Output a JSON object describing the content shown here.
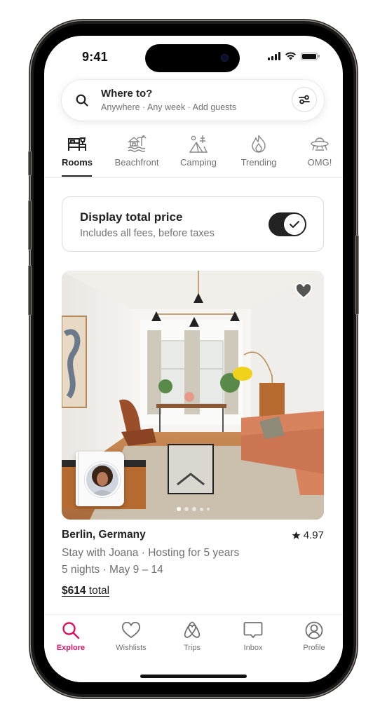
{
  "status_bar": {
    "time": "9:41",
    "icons": [
      "signal-icon",
      "wifi-icon",
      "battery-icon"
    ]
  },
  "search": {
    "title": "Where to?",
    "subtitle": "Anywhere · Any week · Add guests",
    "search_icon": "search-icon",
    "filter_icon": "filter-sliders-icon"
  },
  "categories": {
    "active_index": 0,
    "items": [
      {
        "label": "Rooms",
        "icon": "bed-icon"
      },
      {
        "label": "Beachfront",
        "icon": "beach-hut-icon"
      },
      {
        "label": "Camping",
        "icon": "tent-icon"
      },
      {
        "label": "Trending",
        "icon": "flame-icon"
      },
      {
        "label": "OMG!",
        "icon": "ufo-icon"
      }
    ]
  },
  "price_toggle": {
    "title": "Display total price",
    "subtitle": "Includes all fees, before taxes",
    "enabled": true
  },
  "listing": {
    "location": "Berlin, Germany",
    "rating": "4.97",
    "host_line": "Stay with Joana · Hosting for 5 years",
    "dates_line": "5 nights · May 9 – 14",
    "price": "$614",
    "price_suffix": "total",
    "photo_count": 5,
    "active_photo_index": 0,
    "wishlisted": false
  },
  "tabbar": {
    "active_index": 0,
    "items": [
      {
        "label": "Explore",
        "icon": "search-icon"
      },
      {
        "label": "Wishlists",
        "icon": "heart-icon"
      },
      {
        "label": "Trips",
        "icon": "airbnb-logo-icon"
      },
      {
        "label": "Inbox",
        "icon": "message-icon"
      },
      {
        "label": "Profile",
        "icon": "user-circle-icon"
      }
    ]
  },
  "colors": {
    "brand": "#e0115f",
    "text_primary": "#222222",
    "text_secondary": "#717171"
  }
}
